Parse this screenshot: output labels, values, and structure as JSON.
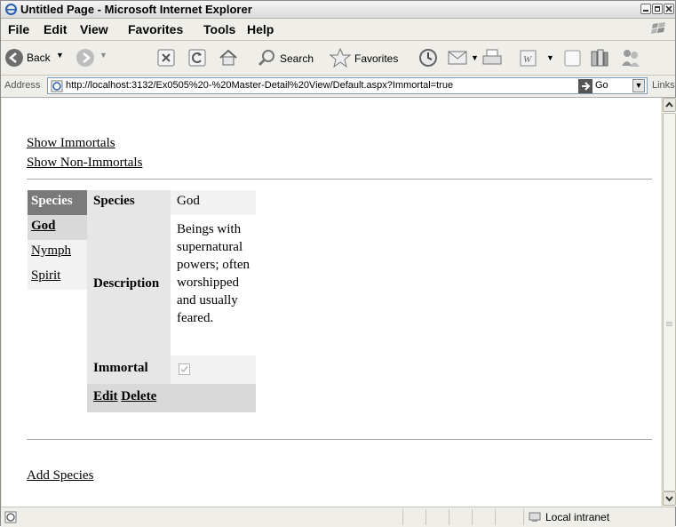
{
  "window": {
    "title": "Untitled Page - Microsoft Internet Explorer"
  },
  "menubar": [
    "File",
    "Edit",
    "View",
    "Favorites",
    "Tools",
    "Help"
  ],
  "toolbar": {
    "back_label": "Back",
    "search_label": "Search",
    "favorites_label": "Favorites"
  },
  "address": {
    "label": "Address",
    "url": "http://localhost:3132/Ex0505%20-%20Master-Detail%20View/Default.aspx?Immortal=true",
    "go_label": "Go",
    "links_label": "Links"
  },
  "page": {
    "show_immortals": "Show Immortals",
    "show_non_immortals": "Show Non-Immortals",
    "master": {
      "header": "Species",
      "items": [
        "God",
        "Nymph",
        "Spirit"
      ],
      "selected": "God"
    },
    "detail": {
      "species_label": "Species",
      "species_value": "God",
      "description_label": "Description",
      "description_value": "Beings with supernatural powers; often worshipped and usually feared.",
      "immortal_label": "Immortal",
      "immortal_checked": true,
      "edit_label": "Edit",
      "delete_label": "Delete"
    },
    "add_species": "Add Species"
  },
  "statusbar": {
    "zone": "Local intranet"
  },
  "colors": {
    "master_header_bg": "#7a7a7a",
    "selected_bg": "#d9d9d9",
    "label_bg": "#e6e6e6",
    "value_bg": "#f2f2f2",
    "footer_bg": "#d9d9d9"
  }
}
